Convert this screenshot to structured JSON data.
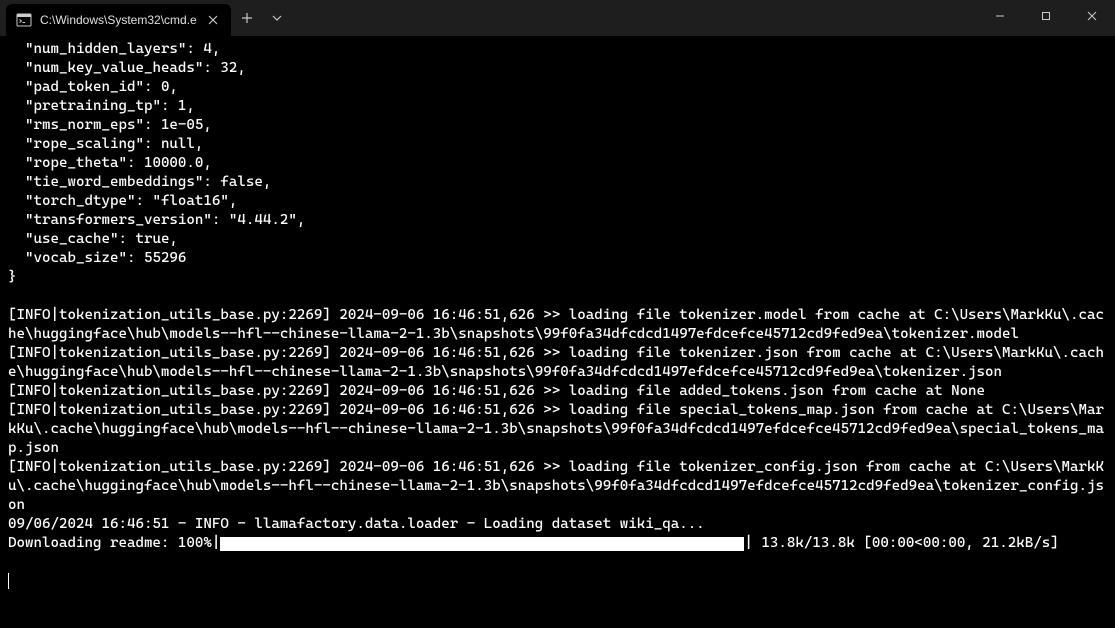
{
  "window": {
    "tab": {
      "title": "C:\\Windows\\System32\\cmd.e"
    }
  },
  "config": {
    "l1": "  \"num_hidden_layers\": 4,",
    "l2": "  \"num_key_value_heads\": 32,",
    "l3": "  \"pad_token_id\": 0,",
    "l4": "  \"pretraining_tp\": 1,",
    "l5": "  \"rms_norm_eps\": 1e-05,",
    "l6": "  \"rope_scaling\": null,",
    "l7": "  \"rope_theta\": 10000.0,",
    "l8": "  \"tie_word_embeddings\": false,",
    "l9": "  \"torch_dtype\": \"float16\",",
    "l10": "  \"transformers_version\": \"4.44.2\",",
    "l11": "  \"use_cache\": true,",
    "l12": "  \"vocab_size\": 55296",
    "l13": "}"
  },
  "logs": {
    "blank": "",
    "l1": "[INFO|tokenization_utils_base.py:2269] 2024-09-06 16:46:51,626 >> loading file tokenizer.model from cache at C:\\Users\\MarkKu\\.cache\\huggingface\\hub\\models--hfl--chinese-llama-2-1.3b\\snapshots\\99f0fa34dfcdcd1497efdcefce45712cd9fed9ea\\tokenizer.model",
    "l2": "[INFO|tokenization_utils_base.py:2269] 2024-09-06 16:46:51,626 >> loading file tokenizer.json from cache at C:\\Users\\MarkKu\\.cache\\huggingface\\hub\\models--hfl--chinese-llama-2-1.3b\\snapshots\\99f0fa34dfcdcd1497efdcefce45712cd9fed9ea\\tokenizer.json",
    "l3": "[INFO|tokenization_utils_base.py:2269] 2024-09-06 16:46:51,626 >> loading file added_tokens.json from cache at None",
    "l4": "[INFO|tokenization_utils_base.py:2269] 2024-09-06 16:46:51,626 >> loading file special_tokens_map.json from cache at C:\\Users\\MarkKu\\.cache\\huggingface\\hub\\models--hfl--chinese-llama-2-1.3b\\snapshots\\99f0fa34dfcdcd1497efdcefce45712cd9fed9ea\\special_tokens_map.json",
    "l5": "[INFO|tokenization_utils_base.py:2269] 2024-09-06 16:46:51,626 >> loading file tokenizer_config.json from cache at C:\\Users\\MarkKu\\.cache\\huggingface\\hub\\models--hfl--chinese-llama-2-1.3b\\snapshots\\99f0fa34dfcdcd1497efdcefce45712cd9fed9ea\\tokenizer_config.json",
    "l6": "09/06/2024 16:46:51 - INFO - llamafactory.data.loader - Loading dataset wiki_qa..."
  },
  "progress": {
    "label": "Downloading readme: 100%",
    "open": "|",
    "close": "|",
    "stats": " 13.8k/13.8k [00:00<00:00, 21.2kB/s]"
  }
}
